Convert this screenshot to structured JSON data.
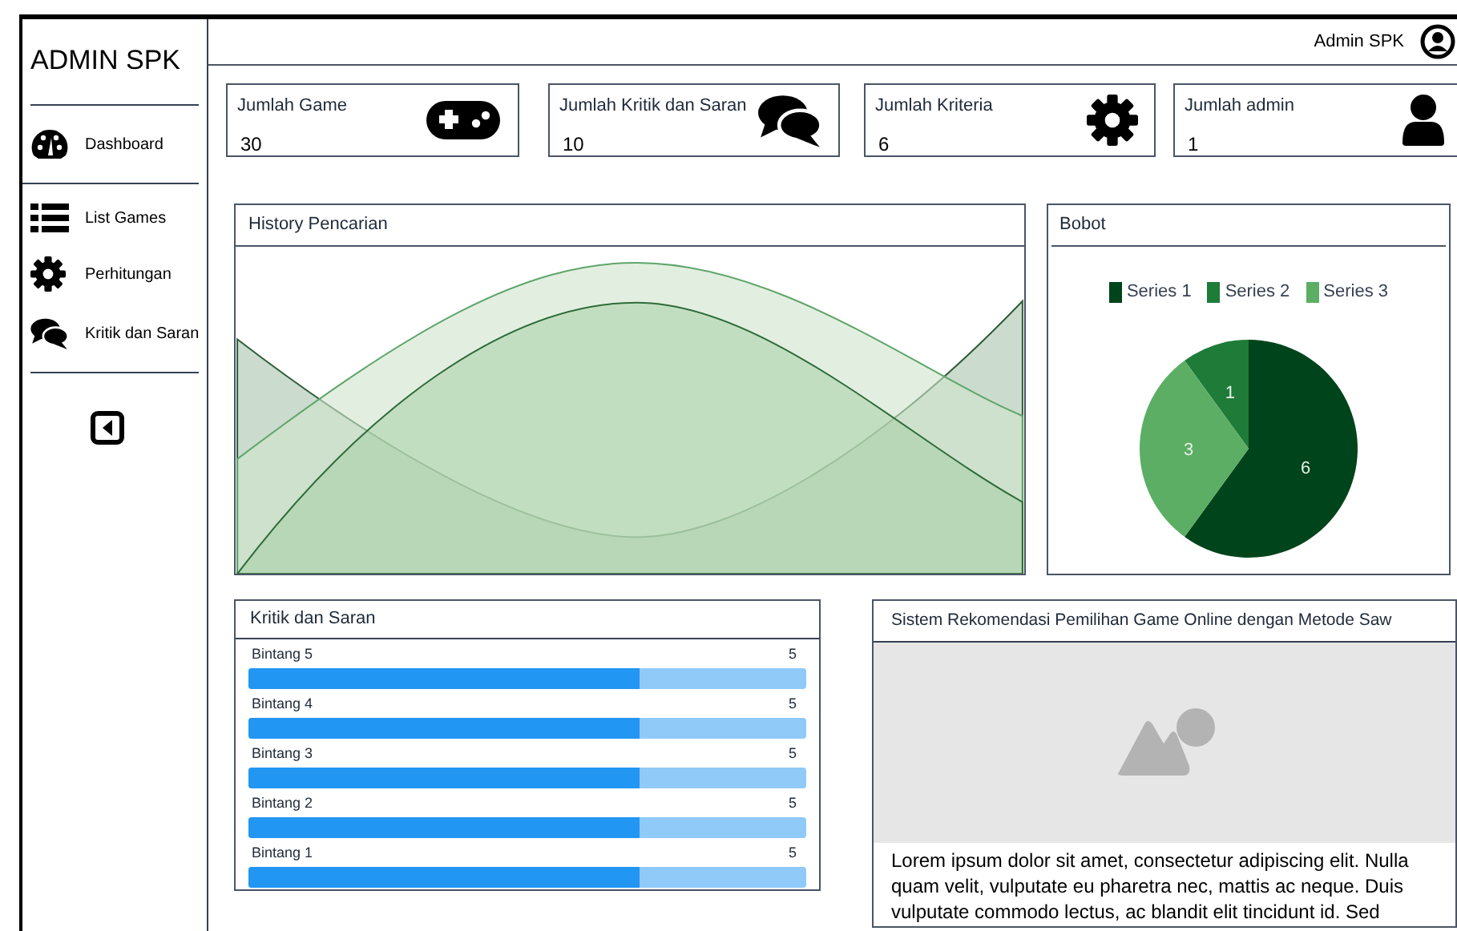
{
  "sidebar": {
    "title": "ADMIN SPK",
    "items": [
      {
        "label": "Dashboard"
      },
      {
        "label": "List Games"
      },
      {
        "label": "Perhitungan"
      },
      {
        "label": "Kritik dan Saran"
      }
    ]
  },
  "header": {
    "user": "Admin SPK"
  },
  "stats": [
    {
      "label": "Jumlah Game",
      "value": "30"
    },
    {
      "label": "Jumlah Kritik dan Saran",
      "value": "10"
    },
    {
      "label": "Jumlah Kriteria",
      "value": "6"
    },
    {
      "label": "Jumlah admin",
      "value": "1"
    }
  ],
  "history": {
    "title": "History Pencarian"
  },
  "bobot": {
    "title": "Bobot",
    "chart_data": {
      "type": "pie",
      "categories": [
        "Series 1",
        "Series 2",
        "Series 3"
      ],
      "values": [
        6,
        1,
        3
      ],
      "colors": [
        "#00441b",
        "#1e7b38",
        "#5bae64"
      ],
      "data_labels": true
    }
  },
  "kritik": {
    "title": "Kritik dan Saran",
    "ratings": [
      {
        "label": "Bintang 5",
        "value": "5",
        "level": 0.7
      },
      {
        "label": "Bintang 4",
        "value": "5",
        "level": 0.7
      },
      {
        "label": "Bintang 3",
        "value": "5",
        "level": 0.7
      },
      {
        "label": "Bintang 2",
        "value": "5",
        "level": 0.7
      },
      {
        "label": "Bintang 1",
        "value": "5",
        "level": 0.7
      }
    ]
  },
  "about": {
    "title": "Sistem Rekomendasi Pemilihan Game Online dengan Metode Saw",
    "text": "Lorem ipsum dolor sit amet, consectetur adipiscing elit. Nulla quam velit, vulputate eu pharetra nec, mattis ac neque. Duis vulputate commodo lectus, ac blandit elit tincidunt id. Sed"
  }
}
